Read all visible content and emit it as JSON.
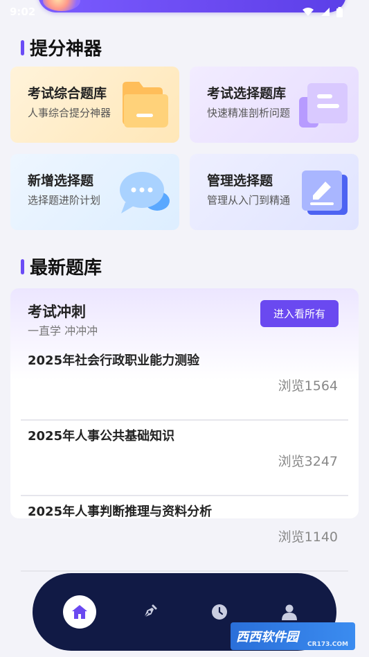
{
  "status_bar": {
    "time": "9:02"
  },
  "tools": {
    "title": "提分神器",
    "cards": [
      {
        "title": "考试综合题库",
        "subtitle": "人事综合提分神器",
        "icon": "folder-icon"
      },
      {
        "title": "考试选择题库",
        "subtitle": "快速精准剖析问题",
        "icon": "document-icon"
      },
      {
        "title": "新增选择题",
        "subtitle": "选择题进阶计划",
        "icon": "chat-bubble-icon"
      },
      {
        "title": "管理选择题",
        "subtitle": "管理从入门到精通",
        "icon": "edit-note-icon"
      }
    ]
  },
  "latest": {
    "title": "最新题库",
    "panel_title": "考试冲刺",
    "panel_subtitle": "一直学 冲冲冲",
    "view_all_label": "进入看所有",
    "items": [
      {
        "name": "2025年社会行政职业能力测验",
        "views": "浏览1564"
      },
      {
        "name": "2025年人事公共基础知识",
        "views": "浏览3247"
      },
      {
        "name": "2025年人事判断推理与资料分析",
        "views": "浏览1140"
      }
    ]
  },
  "bottom_nav": {
    "items": [
      {
        "icon": "home-icon",
        "active": true
      },
      {
        "icon": "pen-nib-icon",
        "active": false
      },
      {
        "icon": "clock-icon",
        "active": false
      },
      {
        "icon": "user-icon",
        "active": false
      }
    ]
  },
  "watermark": {
    "text": "西西软件园",
    "sub": "CR173.COM"
  },
  "colors": {
    "accent": "#6a49f0",
    "nav_bg": "#111a45",
    "page_bg": "#f3f3f9"
  }
}
